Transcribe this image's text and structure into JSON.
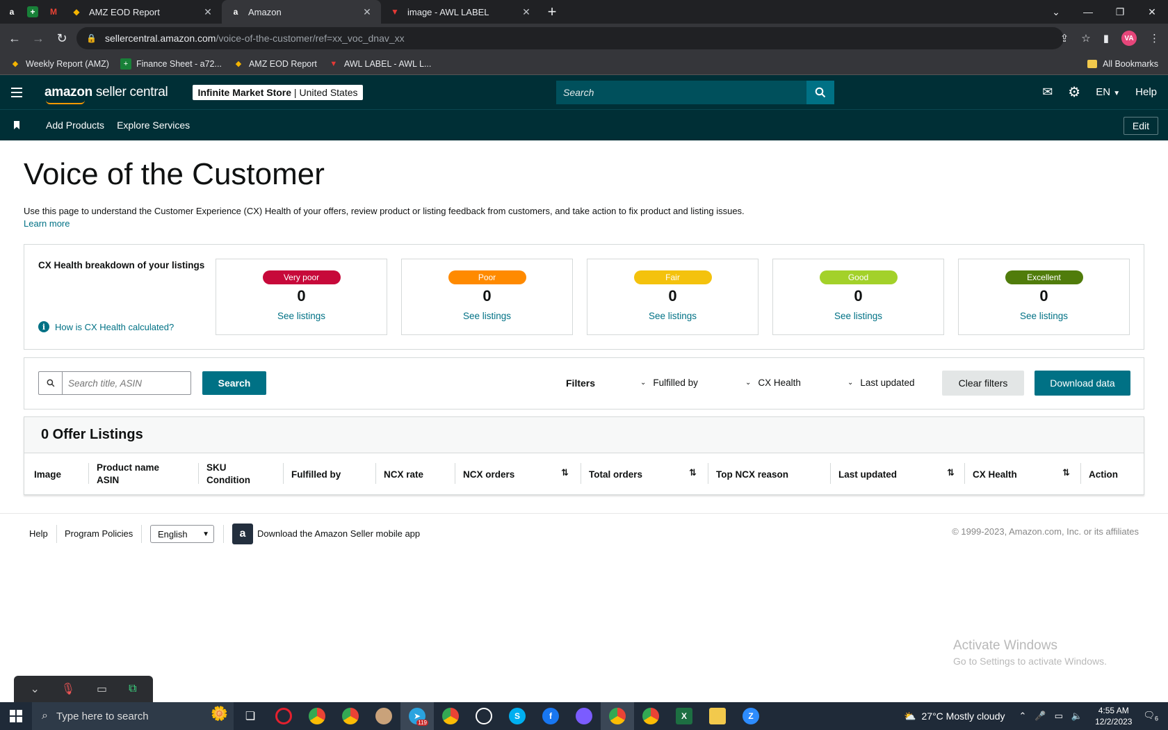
{
  "browser": {
    "tabs": [
      {
        "title": "AMZ EOD Report",
        "active": false
      },
      {
        "title": "Amazon",
        "active": true
      },
      {
        "title": "image - AWL LABEL",
        "active": false
      }
    ],
    "url_host": "sellercentral.amazon.com",
    "url_path": "/voice-of-the-customer/ref=xx_voc_dnav_xx",
    "profile_initials": "VA",
    "bookmarks": [
      "Weekly Report (AMZ)",
      "Finance Sheet - a72...",
      "AMZ EOD Report",
      "AWL LABEL - AWL L..."
    ],
    "all_bookmarks": "All Bookmarks"
  },
  "header": {
    "logo_text_bold": "amazon",
    "logo_text": " seller central",
    "store_name": "Infinite Market Store",
    "store_region": " | United States",
    "search_placeholder": "Search",
    "language": "EN",
    "help": "Help"
  },
  "nav": {
    "links": [
      "Add Products",
      "Explore Services"
    ],
    "edit": "Edit"
  },
  "page": {
    "title": "Voice of the Customer",
    "description": "Use this page to understand the Customer Experience (CX) Health of your offers, review product or listing feedback from customers, and take action to fix product and listing issues.",
    "learn_more": "Learn more"
  },
  "cx_health": {
    "label": "CX Health breakdown of your listings",
    "how_link": "How is CX Health calculated?",
    "cards": [
      {
        "label": "Very poor",
        "count": "0",
        "link": "See listings",
        "color": "#c7093a"
      },
      {
        "label": "Poor",
        "count": "0",
        "link": "See listings",
        "color": "#ff8a00"
      },
      {
        "label": "Fair",
        "count": "0",
        "link": "See listings",
        "color": "#f4c20d"
      },
      {
        "label": "Good",
        "count": "0",
        "link": "See listings",
        "color": "#a3d12a"
      },
      {
        "label": "Excellent",
        "count": "0",
        "link": "See listings",
        "color": "#507c0b"
      }
    ]
  },
  "filters": {
    "search_placeholder": "Search title, ASIN",
    "search_button": "Search",
    "filters_label": "Filters",
    "dropdowns": [
      "Fulfilled by",
      "CX Health",
      "Last updated"
    ],
    "clear": "Clear filters",
    "download": "Download data"
  },
  "listings": {
    "heading": "0 Offer Listings",
    "columns": {
      "image": "Image",
      "product_name": "Product name",
      "asin": "ASIN",
      "sku": "SKU",
      "condition": "Condition",
      "fulfilled_by": "Fulfilled by",
      "ncx_rate": "NCX rate",
      "ncx_orders": "NCX orders",
      "total_orders": "Total orders",
      "top_ncx_reason": "Top NCX reason",
      "last_updated": "Last updated",
      "cx_health": "CX Health",
      "action": "Action"
    }
  },
  "footer": {
    "help": "Help",
    "program_policies": "Program Policies",
    "language": "English",
    "app_text": "Download the Amazon Seller mobile app",
    "copyright": "© 1999-2023, Amazon.com, Inc. or its affiliates"
  },
  "watermark": {
    "line1": "Activate Windows",
    "line2": "Go to Settings to activate Windows."
  },
  "taskbar": {
    "search_placeholder": "Type here to search",
    "weather": "27°C  Mostly cloudy",
    "time": "4:55 AM",
    "date": "12/2/2023",
    "notification_count": "6",
    "telegram_badge": "119"
  }
}
